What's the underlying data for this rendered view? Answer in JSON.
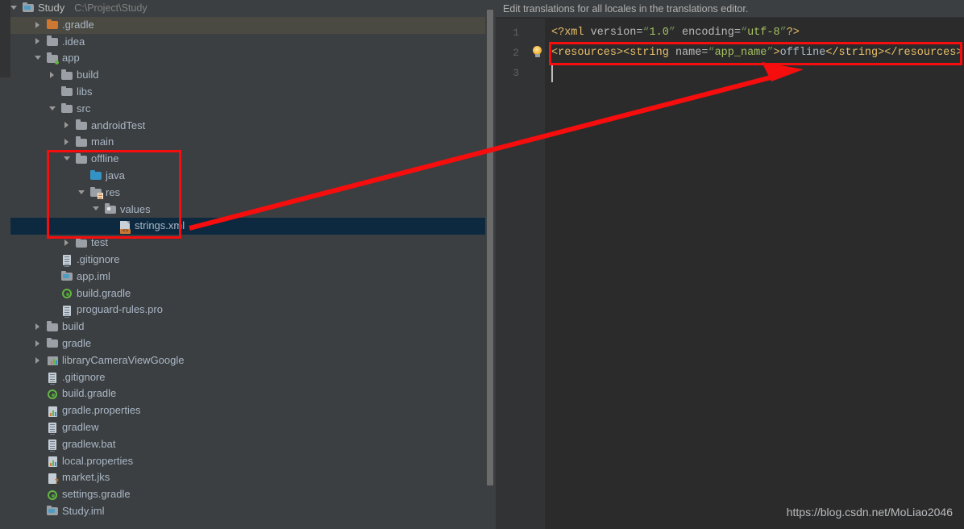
{
  "project": {
    "root_label": "Study",
    "root_path": "C:\\Project\\Study",
    "tree": [
      {
        "label": ".gradle",
        "indent": 1,
        "arrow": "right",
        "icon": "folder-orange"
      },
      {
        "label": ".idea",
        "indent": 1,
        "arrow": "right",
        "icon": "folder-grey"
      },
      {
        "label": "app",
        "indent": 1,
        "arrow": "down",
        "icon": "folder-module"
      },
      {
        "label": "build",
        "indent": 2,
        "arrow": "right",
        "icon": "folder-grey"
      },
      {
        "label": "libs",
        "indent": 2,
        "arrow": "none",
        "icon": "folder-grey"
      },
      {
        "label": "src",
        "indent": 2,
        "arrow": "down",
        "icon": "folder-grey"
      },
      {
        "label": "androidTest",
        "indent": 3,
        "arrow": "right",
        "icon": "folder-grey"
      },
      {
        "label": "main",
        "indent": 3,
        "arrow": "right",
        "icon": "folder-grey"
      },
      {
        "label": "offline",
        "indent": 3,
        "arrow": "down",
        "icon": "folder-grey"
      },
      {
        "label": "java",
        "indent": 4,
        "arrow": "none",
        "icon": "folder-blue"
      },
      {
        "label": "res",
        "indent": 4,
        "arrow": "down",
        "icon": "folder-res"
      },
      {
        "label": "values",
        "indent": 5,
        "arrow": "down",
        "icon": "folder-values"
      },
      {
        "label": "strings.xml",
        "indent": 6,
        "arrow": "none",
        "icon": "xml-file"
      },
      {
        "label": "test",
        "indent": 3,
        "arrow": "right",
        "icon": "folder-grey"
      },
      {
        "label": ".gitignore",
        "indent": 2,
        "arrow": "none",
        "icon": "text-file"
      },
      {
        "label": "app.iml",
        "indent": 2,
        "arrow": "none",
        "icon": "iml-file"
      },
      {
        "label": "build.gradle",
        "indent": 2,
        "arrow": "none",
        "icon": "gradle-file"
      },
      {
        "label": "proguard-rules.pro",
        "indent": 2,
        "arrow": "none",
        "icon": "text-file"
      },
      {
        "label": "build",
        "indent": 1,
        "arrow": "right",
        "icon": "folder-grey"
      },
      {
        "label": "gradle",
        "indent": 1,
        "arrow": "right",
        "icon": "folder-grey"
      },
      {
        "label": "libraryCameraViewGoogle",
        "indent": 1,
        "arrow": "right",
        "icon": "library-module"
      },
      {
        "label": ".gitignore",
        "indent": 1,
        "arrow": "none",
        "icon": "text-file"
      },
      {
        "label": "build.gradle",
        "indent": 1,
        "arrow": "none",
        "icon": "gradle-file"
      },
      {
        "label": "gradle.properties",
        "indent": 1,
        "arrow": "none",
        "icon": "properties-file"
      },
      {
        "label": "gradlew",
        "indent": 1,
        "arrow": "none",
        "icon": "text-file"
      },
      {
        "label": "gradlew.bat",
        "indent": 1,
        "arrow": "none",
        "icon": "text-file"
      },
      {
        "label": "local.properties",
        "indent": 1,
        "arrow": "none",
        "icon": "properties-file"
      },
      {
        "label": "market.jks",
        "indent": 1,
        "arrow": "none",
        "icon": "key-file"
      },
      {
        "label": "settings.gradle",
        "indent": 1,
        "arrow": "none",
        "icon": "gradle-file"
      },
      {
        "label": "Study.iml",
        "indent": 1,
        "arrow": "none",
        "icon": "iml-file"
      }
    ],
    "selected_index": 12,
    "hovered_index": 0
  },
  "editor": {
    "notice": "Edit translations for all locales in the translations editor.",
    "line_numbers": [
      "1",
      "2",
      "3"
    ],
    "line1": {
      "open": "<?xml ",
      "attr1": "version=",
      "q1a": "“",
      "val1": "1.0",
      "q1b": "”",
      "attr2": " encoding=",
      "q2a": "“",
      "val2": "utf-8",
      "q2b": "”",
      "close": "?>"
    },
    "line2": {
      "t_open_resources": "<resources>",
      "t_open_string": "<string ",
      "attr_name": "name=",
      "q_a": "“",
      "attr_value": "app_name",
      "q_b": "”",
      "gt": ">",
      "text": "offline",
      "t_close_string": "</string>",
      "t_close_resources": "</resources>"
    },
    "gutter_icon": "lightbulb-icon"
  },
  "annotations": {
    "tree_highlight_box": "red-rectangle-around-offline-subtree",
    "code_highlight_box": "red-rectangle-around-line-2",
    "arrow": "red-arrow-from-strings-xml-to-code-line-2",
    "color": "#f60d0d"
  },
  "watermark": {
    "text": "https://blog.csdn.net/MoLiao2046"
  }
}
